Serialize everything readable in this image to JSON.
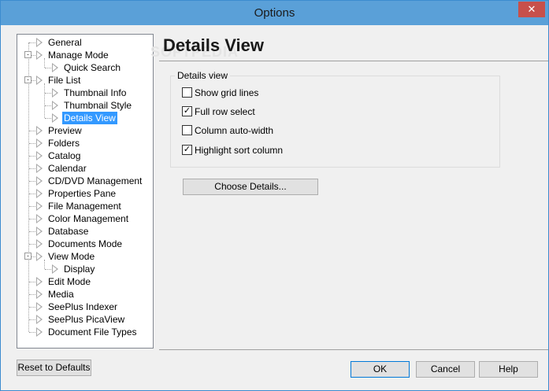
{
  "window": {
    "title": "Options",
    "close_glyph": "✕"
  },
  "watermark": "SOFTPEDIA",
  "tree": [
    {
      "label": "General",
      "level": 0,
      "expander": "",
      "selected": false
    },
    {
      "label": "Manage Mode",
      "level": 0,
      "expander": "-",
      "selected": false
    },
    {
      "label": "Quick Search",
      "level": 1,
      "expander": "",
      "selected": false
    },
    {
      "label": "File List",
      "level": 0,
      "expander": "-",
      "selected": false
    },
    {
      "label": "Thumbnail Info",
      "level": 1,
      "expander": "",
      "selected": false
    },
    {
      "label": "Thumbnail Style",
      "level": 1,
      "expander": "",
      "selected": false
    },
    {
      "label": "Details View",
      "level": 1,
      "expander": "",
      "selected": true
    },
    {
      "label": "Preview",
      "level": 0,
      "expander": "",
      "selected": false
    },
    {
      "label": "Folders",
      "level": 0,
      "expander": "",
      "selected": false
    },
    {
      "label": "Catalog",
      "level": 0,
      "expander": "",
      "selected": false
    },
    {
      "label": "Calendar",
      "level": 0,
      "expander": "",
      "selected": false
    },
    {
      "label": "CD/DVD Management",
      "level": 0,
      "expander": "",
      "selected": false
    },
    {
      "label": "Properties Pane",
      "level": 0,
      "expander": "",
      "selected": false
    },
    {
      "label": "File Management",
      "level": 0,
      "expander": "",
      "selected": false
    },
    {
      "label": "Color Management",
      "level": 0,
      "expander": "",
      "selected": false
    },
    {
      "label": "Database",
      "level": 0,
      "expander": "",
      "selected": false
    },
    {
      "label": "Documents Mode",
      "level": 0,
      "expander": "",
      "selected": false
    },
    {
      "label": "View Mode",
      "level": 0,
      "expander": "-",
      "selected": false
    },
    {
      "label": "Display",
      "level": 1,
      "expander": "",
      "selected": false
    },
    {
      "label": "Edit Mode",
      "level": 0,
      "expander": "",
      "selected": false
    },
    {
      "label": "Media",
      "level": 0,
      "expander": "",
      "selected": false
    },
    {
      "label": "SeePlus Indexer",
      "level": 0,
      "expander": "",
      "selected": false
    },
    {
      "label": "SeePlus PicaView",
      "level": 0,
      "expander": "",
      "selected": false
    },
    {
      "label": "Document File Types",
      "level": 0,
      "expander": "",
      "selected": false
    }
  ],
  "panel": {
    "title": "Details View",
    "group_label": "Details view",
    "options": [
      {
        "label": "Show grid lines",
        "checked": false
      },
      {
        "label": "Full row select",
        "checked": true
      },
      {
        "label": "Column auto-width",
        "checked": false
      },
      {
        "label": "Highlight sort column",
        "checked": true
      }
    ],
    "choose_details_label": "Choose Details..."
  },
  "footer": {
    "reset_label": "Reset to Defaults",
    "ok_label": "OK",
    "cancel_label": "Cancel",
    "help_label": "Help"
  },
  "colors": {
    "titlebar": "#5aa0d8",
    "selection": "#3399ff",
    "close_button": "#c7504b"
  }
}
